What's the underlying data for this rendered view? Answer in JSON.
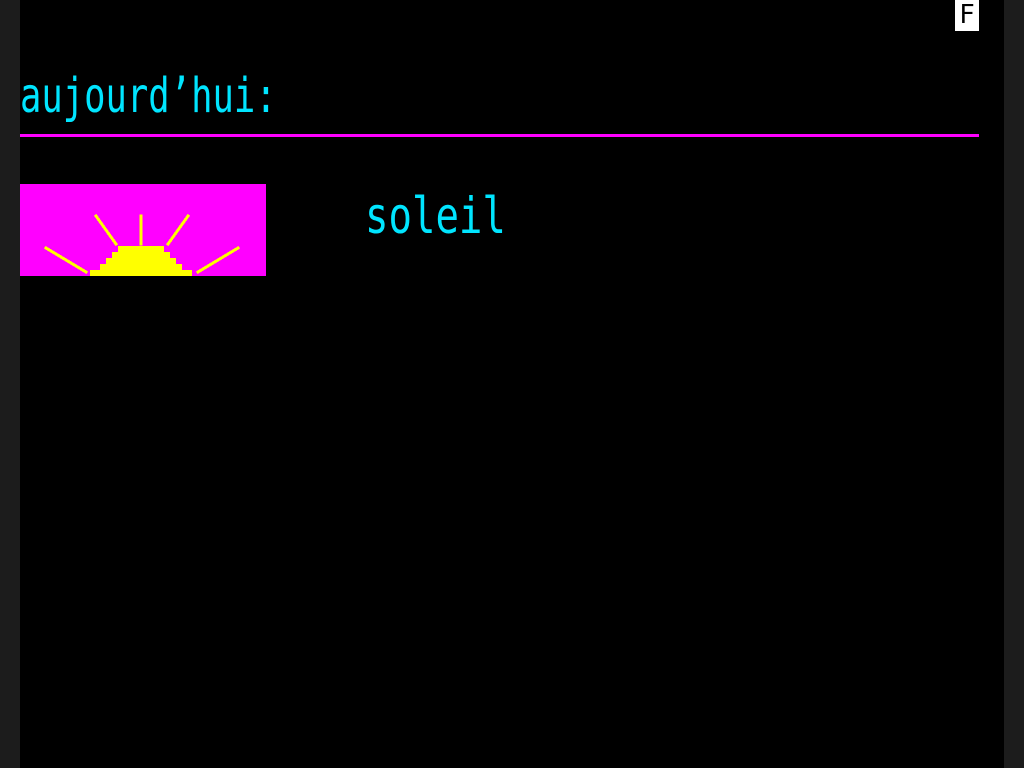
{
  "badge": {
    "label": "F"
  },
  "header": {
    "title": "aujourd’hui:"
  },
  "weather": {
    "icon": "sun-icon",
    "condition": "soleil"
  },
  "colors": {
    "background": "#000000",
    "text": "#00e5ff",
    "accent": "#ff00ff",
    "sun": "#ffff00",
    "badge_bg": "#ffffff"
  }
}
